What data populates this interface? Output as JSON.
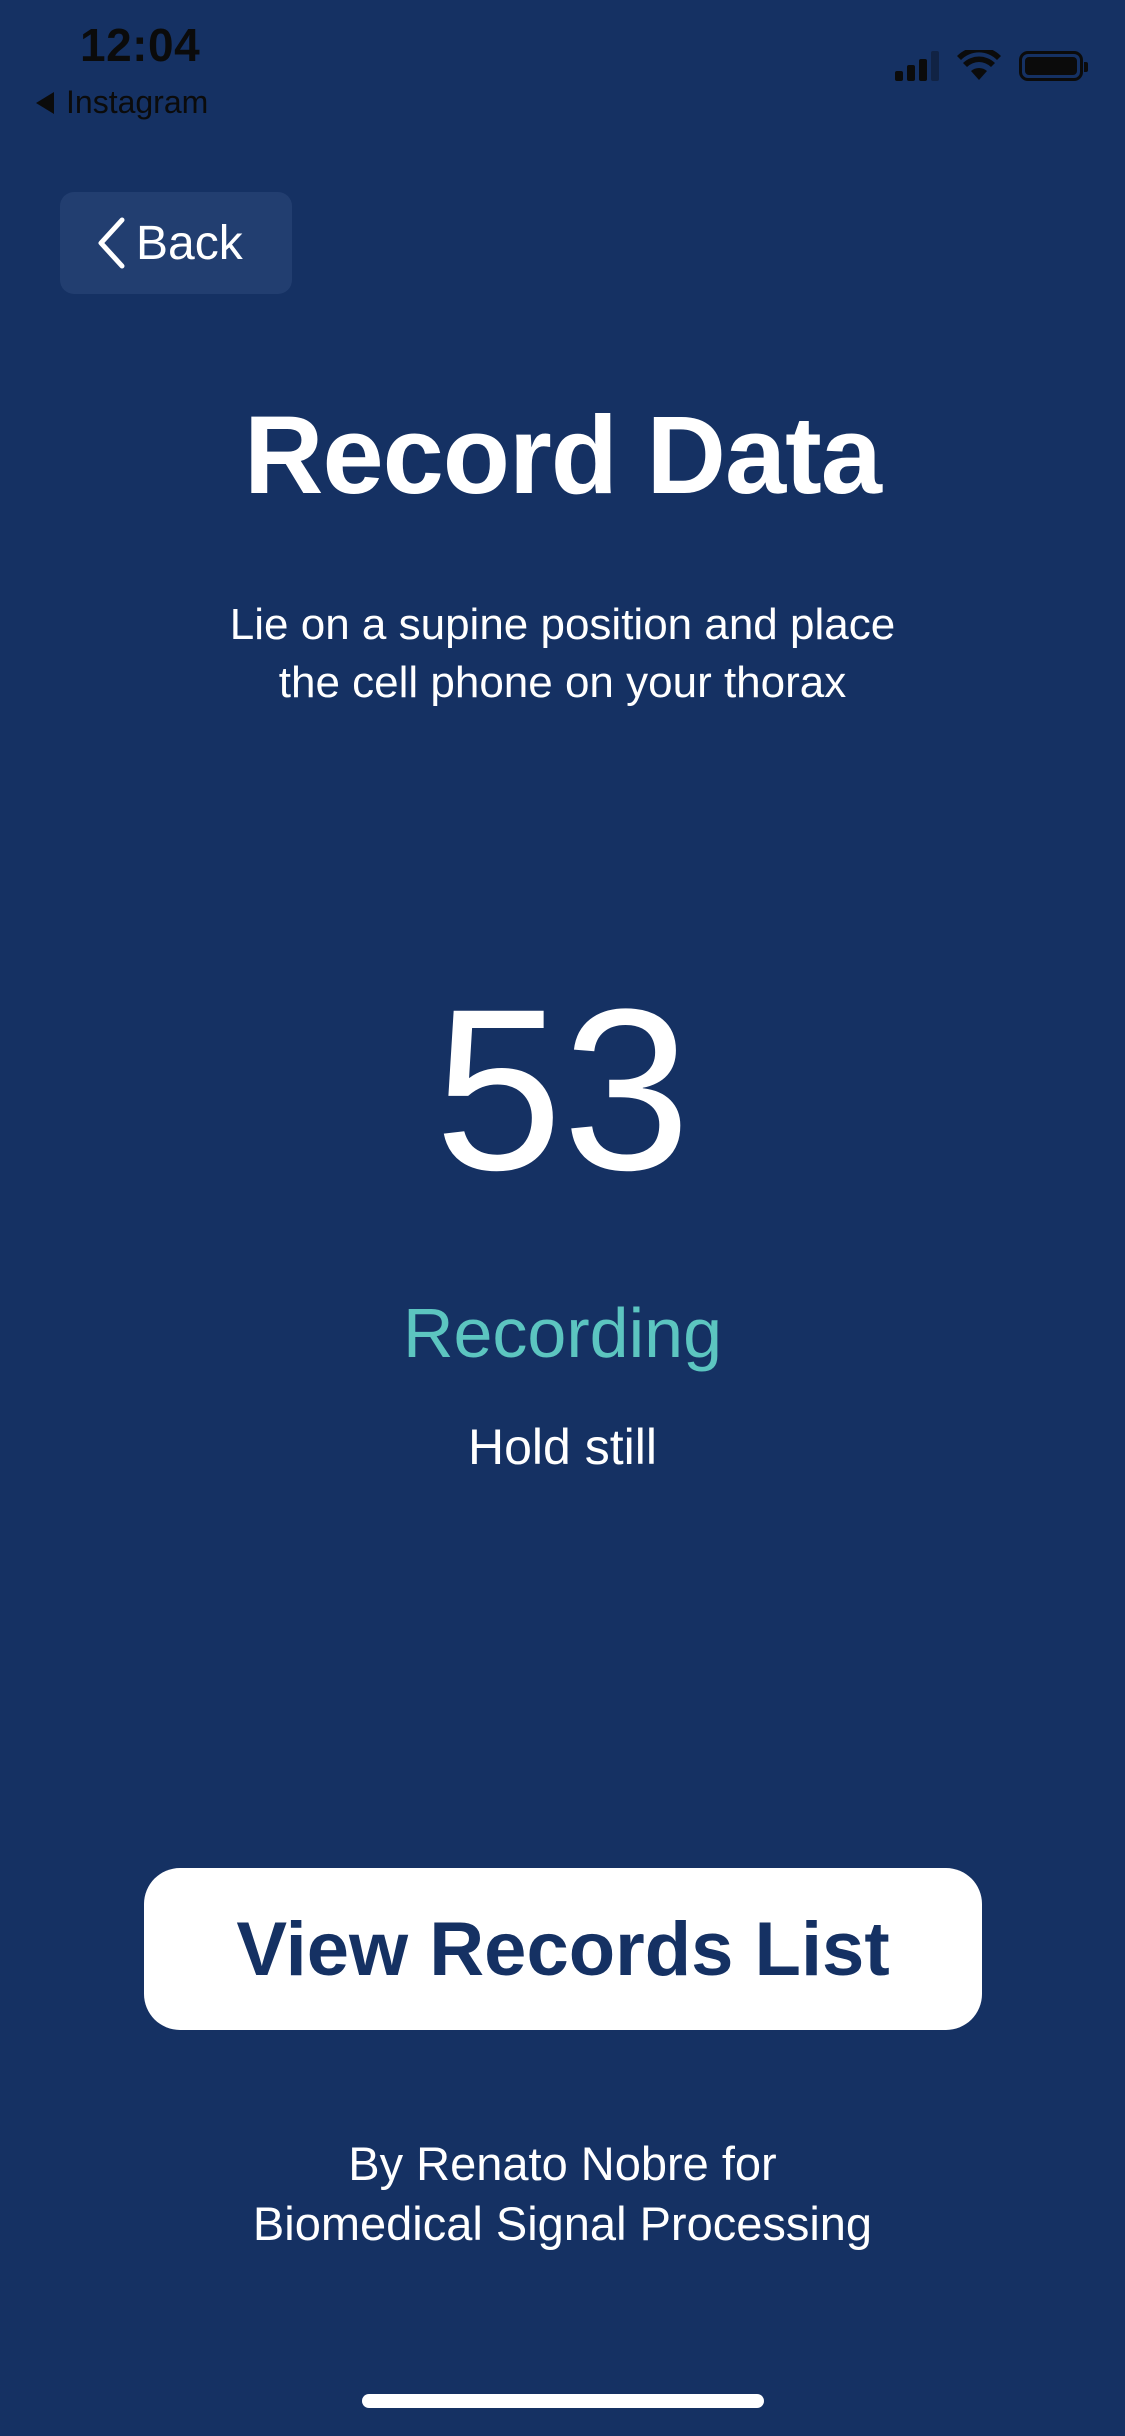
{
  "status_bar": {
    "time": "12:04",
    "back_app_label": "Instagram"
  },
  "nav": {
    "back_label": "Back"
  },
  "screen": {
    "title": "Record Data",
    "instruction_line1": "Lie on a supine position and place",
    "instruction_line2": "the cell phone on your thorax",
    "countdown": "53",
    "recording_status": "Recording",
    "recording_hint": "Hold still",
    "view_records_label": "View Records List",
    "credits_line1": "By Renato Nobre for",
    "credits_line2": "Biomedical Signal Processing"
  },
  "colors": {
    "background": "#153163",
    "accent": "#5cc5c0",
    "button_bg": "#ffffff",
    "button_text": "#153163"
  },
  "icons": {
    "back": "chevron-left-icon",
    "status_back": "back-triangle-icon",
    "signal": "cellular-signal-icon",
    "wifi": "wifi-icon",
    "battery": "battery-icon"
  }
}
